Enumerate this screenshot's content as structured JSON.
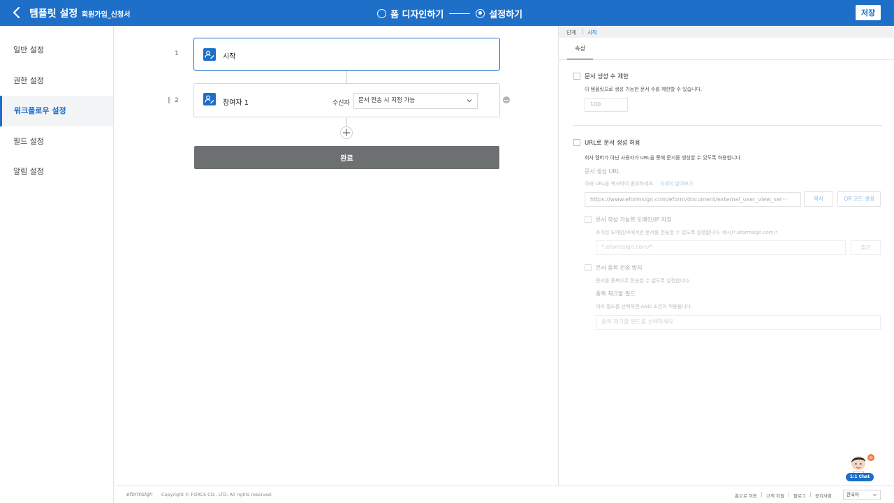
{
  "header": {
    "title": "템플릿 설정",
    "template_name": "회원가입_신청서",
    "steps": [
      {
        "label": "폼 디자인하기",
        "active": false
      },
      {
        "label": "설정하기",
        "active": true
      }
    ],
    "save_label": "저장",
    "color": "#1d6fc7"
  },
  "sidebar": {
    "items": [
      {
        "label": "일반 설정"
      },
      {
        "label": "권한 설정"
      },
      {
        "label": "워크플로우 설정"
      },
      {
        "label": "필드 설정"
      },
      {
        "label": "알림 설정"
      }
    ],
    "active_index": 2
  },
  "workflow": {
    "steps": [
      {
        "number": "1",
        "label": "시작",
        "icon": "user-edit-icon"
      },
      {
        "number": "2",
        "label": "참여자 1",
        "icon": "user-edit-icon",
        "recipient_label": "수신자",
        "recipient_value": "문서 전송 시 지정 가능"
      }
    ],
    "done_label": "완료"
  },
  "panel": {
    "breadcrumb": [
      "단계",
      "시작"
    ],
    "tab_label": "속성",
    "limit": {
      "label": "문서 생성 수 제한",
      "desc": "이 템플릿으로 생성 가능한 문서 수를 제한할 수 있습니다.",
      "value": "100"
    },
    "url": {
      "label": "URL로 문서 생성 허용",
      "desc": "회사 멤버가 아닌 사용자가 URL을 통해 문서를 생성할 수 있도록 허용합니다.",
      "url_title": "문서 생성 URL",
      "url_hint": "아래 URL을 복사하여 공유하세요.",
      "learn_more": "자세히 알아보기",
      "url_value": "https://www.eformsign.com/eform/document/external_user_view_ser···",
      "copy_label": "복사",
      "qr_label": "QR 코드 생성"
    },
    "domain": {
      "label": "문서 작성 가능한 도메인/IP 지정",
      "desc": "추가된 도메인/IP에서만 문서를 전송할 수 있도록 설정합니다. 예시)*.eformsign.com/*",
      "placeholder": "*.eformsign.com/*",
      "add_label": "추가"
    },
    "dup": {
      "label": "문서 중복 전송 방지",
      "desc": "문서를 중복으로 전송할 수 없도록 설정합니다.",
      "field_title": "중복 체크할 필드",
      "field_desc": "여러 필드를 선택하면 AND 조건이 적용됩니다.",
      "field_placeholder": "중복 체크할 필드를 선택하세요"
    }
  },
  "footer": {
    "logo": "eformsign",
    "copyright": "Copyright © FORCS CO., LTD. All rights reserved.",
    "links": [
      "홈으로 이동",
      "고객 지원",
      "블로그",
      "공지사항"
    ],
    "language": "한국어"
  },
  "chat": {
    "label": "1:1 Chat"
  }
}
